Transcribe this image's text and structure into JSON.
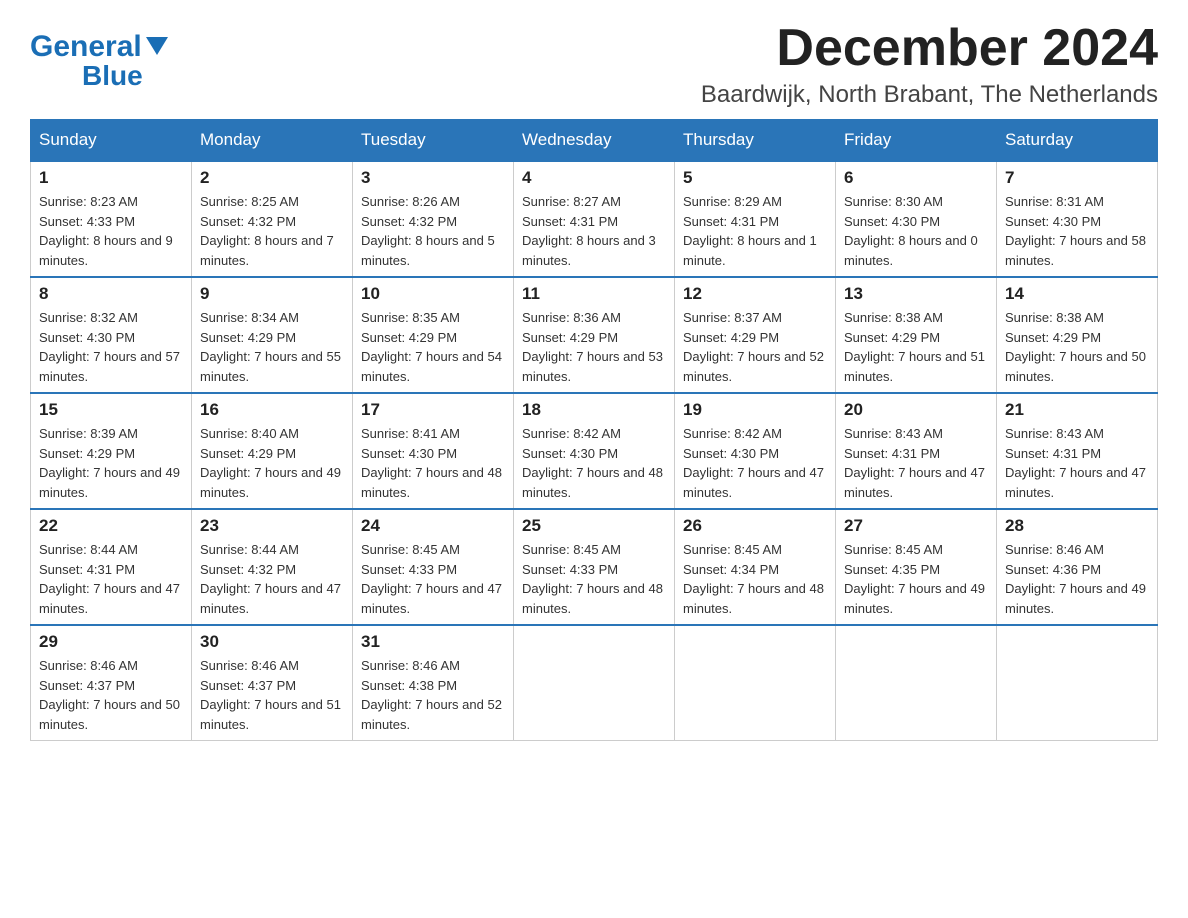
{
  "header": {
    "logo_general": "General",
    "logo_blue": "Blue",
    "month_title": "December 2024",
    "location": "Baardwijk, North Brabant, The Netherlands"
  },
  "weekdays": [
    "Sunday",
    "Monday",
    "Tuesday",
    "Wednesday",
    "Thursday",
    "Friday",
    "Saturday"
  ],
  "weeks": [
    [
      {
        "day": "1",
        "sunrise": "8:23 AM",
        "sunset": "4:33 PM",
        "daylight": "8 hours and 9 minutes."
      },
      {
        "day": "2",
        "sunrise": "8:25 AM",
        "sunset": "4:32 PM",
        "daylight": "8 hours and 7 minutes."
      },
      {
        "day": "3",
        "sunrise": "8:26 AM",
        "sunset": "4:32 PM",
        "daylight": "8 hours and 5 minutes."
      },
      {
        "day": "4",
        "sunrise": "8:27 AM",
        "sunset": "4:31 PM",
        "daylight": "8 hours and 3 minutes."
      },
      {
        "day": "5",
        "sunrise": "8:29 AM",
        "sunset": "4:31 PM",
        "daylight": "8 hours and 1 minute."
      },
      {
        "day": "6",
        "sunrise": "8:30 AM",
        "sunset": "4:30 PM",
        "daylight": "8 hours and 0 minutes."
      },
      {
        "day": "7",
        "sunrise": "8:31 AM",
        "sunset": "4:30 PM",
        "daylight": "7 hours and 58 minutes."
      }
    ],
    [
      {
        "day": "8",
        "sunrise": "8:32 AM",
        "sunset": "4:30 PM",
        "daylight": "7 hours and 57 minutes."
      },
      {
        "day": "9",
        "sunrise": "8:34 AM",
        "sunset": "4:29 PM",
        "daylight": "7 hours and 55 minutes."
      },
      {
        "day": "10",
        "sunrise": "8:35 AM",
        "sunset": "4:29 PM",
        "daylight": "7 hours and 54 minutes."
      },
      {
        "day": "11",
        "sunrise": "8:36 AM",
        "sunset": "4:29 PM",
        "daylight": "7 hours and 53 minutes."
      },
      {
        "day": "12",
        "sunrise": "8:37 AM",
        "sunset": "4:29 PM",
        "daylight": "7 hours and 52 minutes."
      },
      {
        "day": "13",
        "sunrise": "8:38 AM",
        "sunset": "4:29 PM",
        "daylight": "7 hours and 51 minutes."
      },
      {
        "day": "14",
        "sunrise": "8:38 AM",
        "sunset": "4:29 PM",
        "daylight": "7 hours and 50 minutes."
      }
    ],
    [
      {
        "day": "15",
        "sunrise": "8:39 AM",
        "sunset": "4:29 PM",
        "daylight": "7 hours and 49 minutes."
      },
      {
        "day": "16",
        "sunrise": "8:40 AM",
        "sunset": "4:29 PM",
        "daylight": "7 hours and 49 minutes."
      },
      {
        "day": "17",
        "sunrise": "8:41 AM",
        "sunset": "4:30 PM",
        "daylight": "7 hours and 48 minutes."
      },
      {
        "day": "18",
        "sunrise": "8:42 AM",
        "sunset": "4:30 PM",
        "daylight": "7 hours and 48 minutes."
      },
      {
        "day": "19",
        "sunrise": "8:42 AM",
        "sunset": "4:30 PM",
        "daylight": "7 hours and 47 minutes."
      },
      {
        "day": "20",
        "sunrise": "8:43 AM",
        "sunset": "4:31 PM",
        "daylight": "7 hours and 47 minutes."
      },
      {
        "day": "21",
        "sunrise": "8:43 AM",
        "sunset": "4:31 PM",
        "daylight": "7 hours and 47 minutes."
      }
    ],
    [
      {
        "day": "22",
        "sunrise": "8:44 AM",
        "sunset": "4:31 PM",
        "daylight": "7 hours and 47 minutes."
      },
      {
        "day": "23",
        "sunrise": "8:44 AM",
        "sunset": "4:32 PM",
        "daylight": "7 hours and 47 minutes."
      },
      {
        "day": "24",
        "sunrise": "8:45 AM",
        "sunset": "4:33 PM",
        "daylight": "7 hours and 47 minutes."
      },
      {
        "day": "25",
        "sunrise": "8:45 AM",
        "sunset": "4:33 PM",
        "daylight": "7 hours and 48 minutes."
      },
      {
        "day": "26",
        "sunrise": "8:45 AM",
        "sunset": "4:34 PM",
        "daylight": "7 hours and 48 minutes."
      },
      {
        "day": "27",
        "sunrise": "8:45 AM",
        "sunset": "4:35 PM",
        "daylight": "7 hours and 49 minutes."
      },
      {
        "day": "28",
        "sunrise": "8:46 AM",
        "sunset": "4:36 PM",
        "daylight": "7 hours and 49 minutes."
      }
    ],
    [
      {
        "day": "29",
        "sunrise": "8:46 AM",
        "sunset": "4:37 PM",
        "daylight": "7 hours and 50 minutes."
      },
      {
        "day": "30",
        "sunrise": "8:46 AM",
        "sunset": "4:37 PM",
        "daylight": "7 hours and 51 minutes."
      },
      {
        "day": "31",
        "sunrise": "8:46 AM",
        "sunset": "4:38 PM",
        "daylight": "7 hours and 52 minutes."
      },
      null,
      null,
      null,
      null
    ]
  ],
  "labels": {
    "sunrise": "Sunrise:",
    "sunset": "Sunset:",
    "daylight": "Daylight:"
  }
}
